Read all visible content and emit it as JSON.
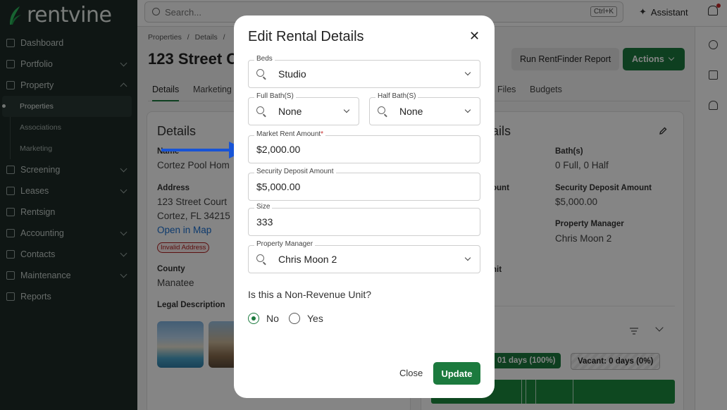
{
  "app": {
    "logo_text": "rentvine"
  },
  "sidebar": {
    "items": [
      {
        "label": "Dashboard",
        "icon": "grid-icon"
      },
      {
        "label": "Portfolio",
        "icon": "folder-icon",
        "expandable": true
      },
      {
        "label": "Property",
        "icon": "building-icon",
        "expandable": true,
        "expanded": true
      },
      {
        "label": "Screening",
        "icon": "screening-icon",
        "expandable": true
      },
      {
        "label": "Leases",
        "icon": "lease-icon",
        "expandable": true
      },
      {
        "label": "Rentsign",
        "icon": "pen-icon"
      },
      {
        "label": "Accounting",
        "icon": "bank-icon",
        "expandable": true
      },
      {
        "label": "Contacts",
        "icon": "contacts-icon",
        "expandable": true
      },
      {
        "label": "Maintenance",
        "icon": "wrench-icon",
        "expandable": true
      },
      {
        "label": "Reports",
        "icon": "chart-icon"
      }
    ],
    "property_sub": [
      "Properties",
      "Associations",
      "Marketing"
    ]
  },
  "topbar": {
    "search_placeholder": "Search...",
    "shortcut": "Ctrl+K",
    "assistant_label": "Assistant"
  },
  "page": {
    "breadcrumb": [
      "Properties",
      "/",
      "Details",
      "/"
    ],
    "title": "123 Street C",
    "run_report_label": "Run RentFinder Report",
    "actions_label": "Actions",
    "tabs": [
      "Details",
      "Marketing",
      "Files",
      "Budgets"
    ],
    "details_card": {
      "title": "Details",
      "name_label": "Name",
      "name_value": "Cortez Pool Hom",
      "address_label": "Address",
      "address_line1": "123 Street Court",
      "address_line2": "Cortez, FL 34215",
      "map_link": "Open in Map",
      "invalid_badge": "Invalid Address",
      "county_label": "County",
      "county_value": "Manatee",
      "legal_label": "Legal Description"
    },
    "unit_card": {
      "title_partial": "ails",
      "baths_label": "Bath(s)",
      "baths_value": "0 Full, 0 Half",
      "amount_partial": "ount",
      "deposit_label": "Security Deposit Amount",
      "deposit_value": "$5,000.00",
      "manager_label": "Property Manager",
      "manager_value": "Chris Moon 2",
      "unit_partial": "nit",
      "occupied_pill": "01 days (100%)",
      "vacant_pill": "Vacant: 0 days (0%)"
    }
  },
  "modal": {
    "title": "Edit Rental Details",
    "fields": {
      "beds": {
        "label": "Beds",
        "value": "Studio"
      },
      "full_bath": {
        "label": "Full Bath(S)",
        "value": "None"
      },
      "half_bath": {
        "label": "Half Bath(S)",
        "value": "None"
      },
      "market_rent": {
        "label": "Market Rent Amount",
        "required_mark": "*",
        "value": "$2,000.00"
      },
      "security_deposit": {
        "label": "Security Deposit Amount",
        "value": "$5,000.00"
      },
      "size": {
        "label": "Size",
        "value": "333"
      },
      "property_manager": {
        "label": "Property Manager",
        "value": "Chris Moon 2"
      }
    },
    "non_revenue_question": "Is this a Non-Revenue Unit?",
    "radio_no": "No",
    "radio_yes": "Yes",
    "radio_selected": "No",
    "close_label": "Close",
    "update_label": "Update"
  },
  "colors": {
    "brand_green": "#1c7a3e",
    "sidebar_bg": "#1e2b27",
    "arrow_blue": "#1854d6",
    "error_red": "#c62828"
  }
}
